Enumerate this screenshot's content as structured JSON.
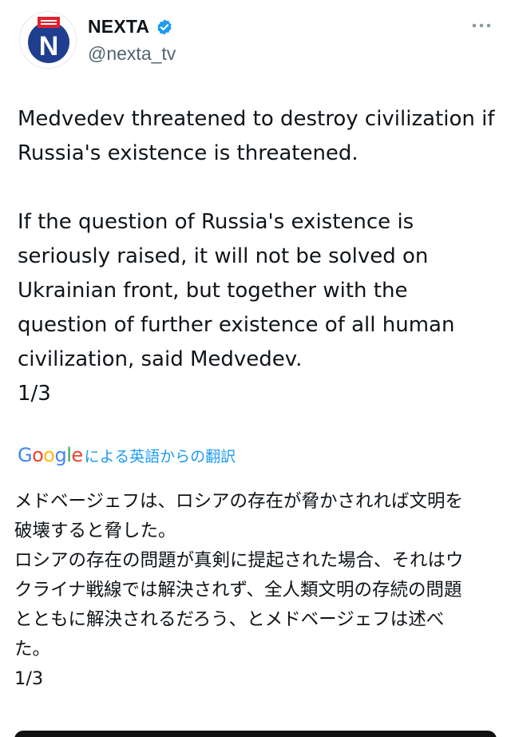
{
  "account": {
    "name": "NEXTA",
    "handle": "@nexta_tv",
    "verified": true,
    "avatar_letter": "N",
    "avatar_icon": "nexta-logo-icon"
  },
  "tweet": {
    "text": "Medvedev threatened to destroy civilization if\nRussia's existence is threatened.\n\nIf the question of Russia's existence is\nseriously raised, it will not be solved on\nUkrainian front, but together with the\nquestion of further existence of all human\ncivilization, said Medvedev.\n1/3"
  },
  "translation": {
    "provider": "Google",
    "label": "による英語からの翻訳",
    "text": "メドベージェフは、ロシアの存在が脅かされれば文明を\n破壊すると脅した。\nロシアの存在の問題が真剣に提起された場合、それはウ\nクライナ戦線では解決されず、全人類文明の存続の問題\nとともに解決されるだろう、とメドベージェフは述べ\nた。\n1/3"
  },
  "colors": {
    "accent": "#1d9bf0",
    "text": "#0f1419",
    "muted": "#536471",
    "nexta_red": "#e0222c",
    "nexta_blue": "#1f3e8f"
  }
}
